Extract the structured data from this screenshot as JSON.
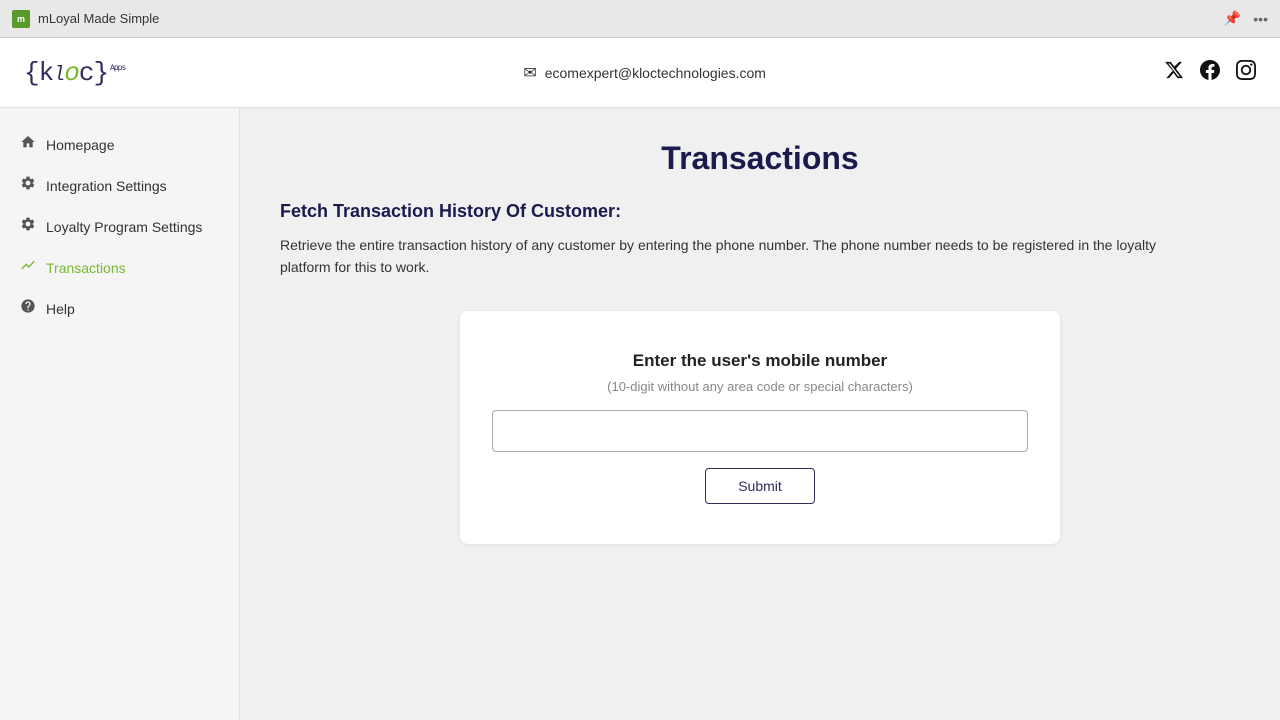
{
  "browser": {
    "title": "mLoyal Made Simple",
    "pin_icon": "📌",
    "more_icon": "···"
  },
  "header": {
    "logo_display": "{kloc}Apps",
    "email": "ecomexpert@kloctechnologies.com",
    "social": [
      "twitter",
      "facebook",
      "instagram"
    ]
  },
  "sidebar": {
    "items": [
      {
        "id": "homepage",
        "label": "Homepage",
        "icon": "home",
        "active": false
      },
      {
        "id": "integration-settings",
        "label": "Integration Settings",
        "icon": "gear",
        "active": false
      },
      {
        "id": "loyalty-program-settings",
        "label": "Loyalty Program Settings",
        "icon": "gear",
        "active": false
      },
      {
        "id": "transactions",
        "label": "Transactions",
        "icon": "chart",
        "active": true
      },
      {
        "id": "help",
        "label": "Help",
        "icon": "info",
        "active": false
      }
    ]
  },
  "main": {
    "page_title": "Transactions",
    "section_heading": "Fetch Transaction History Of Customer:",
    "section_description": "Retrieve the entire transaction history of any customer by entering the phone number. The phone number needs to be registered in the loyalty platform for this to work.",
    "card": {
      "label": "Enter the user's mobile number",
      "sublabel": "(10-digit without any area code or special characters)",
      "input_placeholder": "",
      "submit_label": "Submit"
    }
  }
}
